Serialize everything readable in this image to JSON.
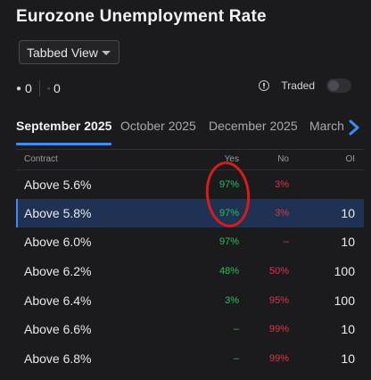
{
  "title": "Eurozone Unemployment Rate",
  "view_select": {
    "value": "Tabbed View"
  },
  "counts": {
    "first": "0",
    "second": "0"
  },
  "traded": {
    "label": "Traded",
    "enabled": false
  },
  "tabs": [
    {
      "label": "September 2025",
      "active": true
    },
    {
      "label": "October 2025",
      "active": false
    },
    {
      "label": "December 2025",
      "active": false
    },
    {
      "label": "March",
      "active": false
    }
  ],
  "table": {
    "headers": {
      "contract": "Contract",
      "yes": "Yes",
      "no": "No",
      "oi": "OI"
    },
    "rows": [
      {
        "contract": "Above 5.6%",
        "yes": "97%",
        "no": "3%",
        "oi": "",
        "highlighted": false
      },
      {
        "contract": "Above 5.8%",
        "yes": "97%",
        "no": "3%",
        "oi": "10",
        "highlighted": true
      },
      {
        "contract": "Above 6.0%",
        "yes": "97%",
        "no": "–",
        "oi": "10",
        "highlighted": false
      },
      {
        "contract": "Above 6.2%",
        "yes": "48%",
        "no": "50%",
        "oi": "100",
        "highlighted": false
      },
      {
        "contract": "Above 6.4%",
        "yes": "3%",
        "no": "95%",
        "oi": "100",
        "highlighted": false
      },
      {
        "contract": "Above 6.6%",
        "yes": "–",
        "no": "99%",
        "oi": "10",
        "highlighted": false
      },
      {
        "contract": "Above 6.8%",
        "yes": "–",
        "no": "99%",
        "oi": "10",
        "highlighted": false
      }
    ]
  },
  "colors": {
    "accent": "#3d8ef0",
    "yes": "#2ebd5f",
    "no": "#e0344a",
    "annotation": "#d81c1c"
  },
  "icons": {
    "select": "chevron-down-icon",
    "info": "info-icon",
    "tabs_next": "chevron-right-icon"
  }
}
